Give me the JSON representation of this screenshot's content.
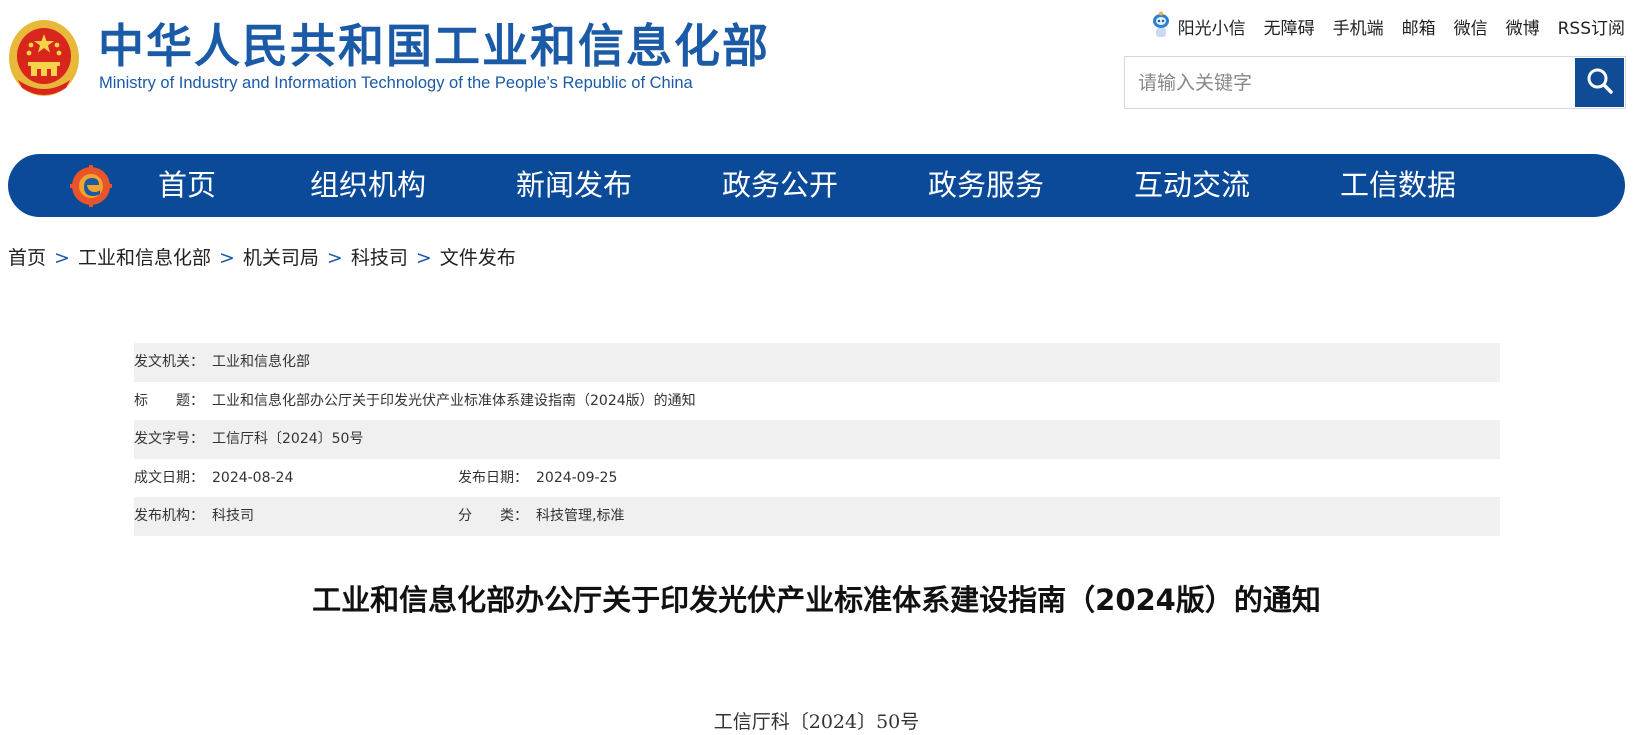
{
  "header": {
    "title_cn": "中华人民共和国工业和信息化部",
    "title_en": "Ministry of Industry and Information Technology of the People’s Republic of China",
    "emblem_icon": "national-emblem-icon",
    "brand_color": "#1b5aa6"
  },
  "toplinks": {
    "items": [
      "阳光小信",
      "无障碍",
      "手机端",
      "邮箱",
      "微信",
      "微博",
      "RSS订阅"
    ]
  },
  "search": {
    "placeholder": "请输入关键字",
    "icon": "search-icon"
  },
  "nav": {
    "color": "#0b4a98",
    "items": [
      "首页",
      "组织机构",
      "新闻发布",
      "政务公开",
      "政务服务",
      "互动交流",
      "工信数据"
    ]
  },
  "breadcrumb": {
    "items": [
      "首页",
      "工业和信息化部",
      "机关司局",
      "科技司",
      "文件发布"
    ],
    "separator": ">"
  },
  "info": {
    "issuer_label": "发文机关：",
    "issuer_value": "工业和信息化部",
    "title_label": "标　　题：",
    "title_value": "工业和信息化部办公厅关于印发光伏产业标准体系建设指南（2024版）的通知",
    "docno_label": "发文字号：",
    "docno_value": "工信厅科〔2024〕50号",
    "written_label": "成文日期：",
    "written_value": "2024-08-24",
    "published_label": "发布日期：",
    "published_value": "2024-09-25",
    "org_label": "发布机构：",
    "org_value": "科技司",
    "category_label": "分　　类：",
    "category_value": "科技管理,标准"
  },
  "article": {
    "title": "工业和信息化部办公厅关于印发光伏产业标准体系建设指南（2024版）的通知",
    "doc_number": "工信厅科〔2024〕50号"
  }
}
